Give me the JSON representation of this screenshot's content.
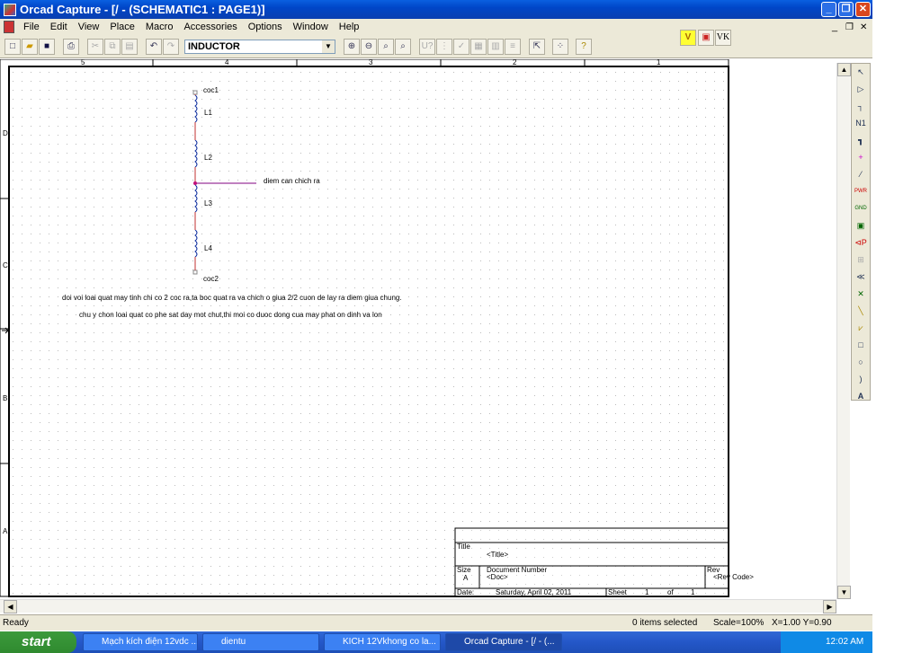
{
  "window": {
    "title": "Orcad Capture - [/ - (SCHEMATIC1 : PAGE1)]"
  },
  "menu": [
    "File",
    "Edit",
    "View",
    "Place",
    "Macro",
    "Accessories",
    "Options",
    "Window",
    "Help"
  ],
  "toolbar": {
    "part_selector": "INDUCTOR",
    "extra_buttons": [
      "V",
      "VK"
    ]
  },
  "ruler": {
    "top": [
      "5",
      "4",
      "3",
      "2",
      "1"
    ],
    "left": [
      "D",
      "C",
      "B",
      "A"
    ]
  },
  "schematic": {
    "ports": [
      "coc1",
      "coc2"
    ],
    "inductors": [
      "L1",
      "L2",
      "L3",
      "L4"
    ],
    "net_label": "diem can chich ra",
    "notes": [
      "doi voi loai quat may tinh chi co 2 coc ra,ta boc quat ra va chich o giua 2/2 cuon de lay ra diem giua chung.",
      "chu y chon loai quat co phe sat day mot chut,thi moi co duoc dong cua may phat on dinh va lon"
    ],
    "colors": {
      "wire": "#c03030",
      "net": "#800080",
      "inductor": "#1030a0"
    }
  },
  "title_block": {
    "title_label": "Title",
    "title_value": "<Title>",
    "size_label": "Size",
    "size_value": "A",
    "docnum_label": "Document Number",
    "docnum_value": "<Doc>",
    "rev_label": "Rev",
    "rev_value": "<Rev Code>",
    "date_label": "Date:",
    "date_value": "Saturday, April 02, 2011",
    "sheet_label": "Sheet",
    "sheet_value": "1",
    "of_label": "of",
    "of_value": "1"
  },
  "status": {
    "ready": "Ready",
    "selection": "0 items selected",
    "scale": "Scale=100%",
    "coords": "X=1.00  Y=0.90"
  },
  "taskbar": {
    "start": "start",
    "tasks": [
      "Mạch kích điện 12vdc ...",
      "dientu",
      "KICH 12Vkhong co la...",
      "Orcad Capture - [/ - (..."
    ],
    "clock": "12:02 AM"
  }
}
